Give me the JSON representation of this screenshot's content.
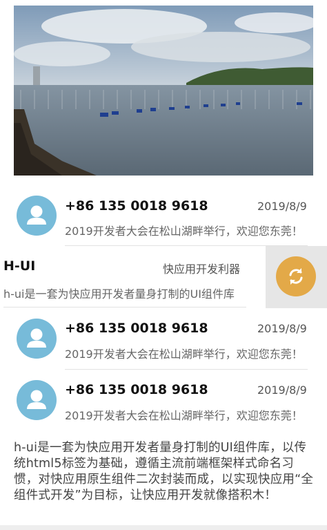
{
  "hero": {
    "icon": "landscape-photo"
  },
  "list": [
    {
      "phone": "+86 135 0018 9618",
      "date": "2019/8/9",
      "snippet": "2019开发者大会在松山湖畔举行，欢迎您东莞！"
    },
    {
      "phone": "+86 135 0018 9618",
      "date": "2019/8/9",
      "snippet": "2019开发者大会在松山湖畔举行，欢迎您东莞！"
    },
    {
      "phone": "+86 135 0018 9618",
      "date": "2019/8/9",
      "snippet": "2019开发者大会在松山湖畔举行，欢迎您东莞！"
    }
  ],
  "swipe": {
    "title": "H-UI",
    "tag": "快应用开发利器",
    "desc": "h-ui是一套为快应用开发者量身打制的UI组件库",
    "action_icon": "refresh-icon"
  },
  "intro_text": "h-ui是一套为快应用开发者量身打制的UI组件库，以传统html5标签为基础，遵循主流前端框架样式命名习惯，对快应用原生组件二次封装而成，以实现快应用“全组件式开发”为目标，让快应用开发就像搭积木！",
  "colors": {
    "avatar": "#77bbd9",
    "accent": "#e3a948",
    "swipe_bg": "#e6e6e6"
  }
}
